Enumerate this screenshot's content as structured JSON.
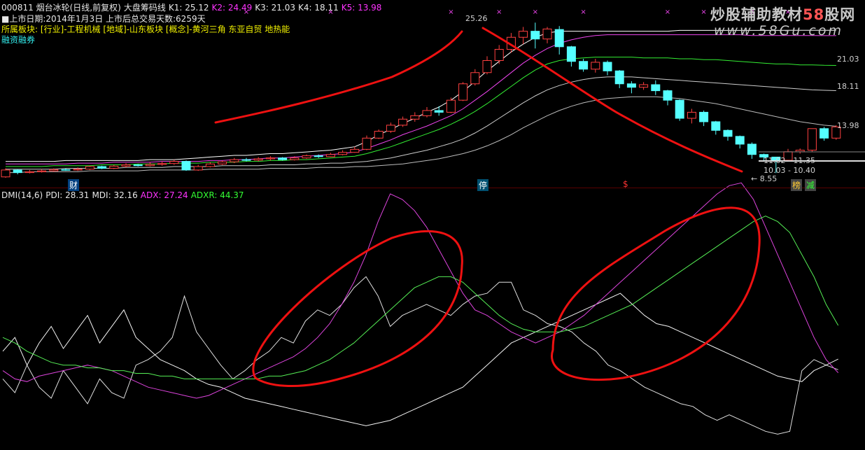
{
  "header": {
    "stock_line": [
      {
        "text": "000811 烟台冰轮(日线,前复权)",
        "color": "white"
      },
      {
        "text": "大盘筹码线",
        "color": "white"
      },
      {
        "text": "K1: 25.12",
        "color": "white"
      },
      {
        "text": "K2: 24.49",
        "color": "magenta"
      },
      {
        "text": "K3: 21.03",
        "color": "white"
      },
      {
        "text": "K4: 18.11",
        "color": "white"
      },
      {
        "text": "K5: 13.98",
        "color": "magenta"
      }
    ],
    "listing_info": "■上市日期:2014年1月3日 上市后总交易天数:6259天",
    "sector_info": "所属板块: [行业]-工程机械 [地域]-山东板块 [概念]-黄河三角 东亚自贸 地热能",
    "margin_tag": "融资融券"
  },
  "watermark": {
    "line1_prefix": "炒股辅助教材",
    "line1_num": "58",
    "line1_suffix": "股网",
    "line2": "www.58Gu.com"
  },
  "price_labels": {
    "peak": "25.26",
    "k3": "21.03",
    "k4": "18.11",
    "k5": "13.98",
    "range1": "11.02 - 11.35",
    "range2": "10.03 - 10.40",
    "low": "← 8.55"
  },
  "markers": {
    "cai": "财",
    "ting": "停",
    "dollar": "$",
    "bang": "榜",
    "jian": "减"
  },
  "dmi_header": [
    {
      "text": "DMI(14,6)",
      "color": "white"
    },
    {
      "text": "PDI: 28.31",
      "color": "white"
    },
    {
      "text": "MDI: 32.16",
      "color": "white"
    },
    {
      "text": "ADX: 27.24",
      "color": "magenta"
    },
    {
      "text": "ADXR: 44.37",
      "color": "green"
    }
  ],
  "chart_data": [
    {
      "type": "candlestick",
      "y_range": [
        8,
        27
      ],
      "candles": [
        [
          8.1,
          8.9,
          8.0,
          9.1
        ],
        [
          8.9,
          8.6,
          8.4,
          9.0
        ],
        [
          8.6,
          8.7,
          8.5,
          8.9
        ],
        [
          8.7,
          8.8,
          8.6,
          9.0
        ],
        [
          8.8,
          8.95,
          8.7,
          9.1
        ],
        [
          8.95,
          8.9,
          8.8,
          9.1
        ],
        [
          8.9,
          9.0,
          8.8,
          9.2
        ],
        [
          9.0,
          9.3,
          8.9,
          9.4
        ],
        [
          9.3,
          9.1,
          9.0,
          9.4
        ],
        [
          9.1,
          9.35,
          9.0,
          9.5
        ],
        [
          9.35,
          9.5,
          9.2,
          9.7
        ],
        [
          9.5,
          9.4,
          9.3,
          9.6
        ],
        [
          9.4,
          9.55,
          9.3,
          9.8
        ],
        [
          9.55,
          9.65,
          9.4,
          9.9
        ],
        [
          9.65,
          9.9,
          9.5,
          10.1
        ],
        [
          9.9,
          8.9,
          8.8,
          10.0
        ],
        [
          8.9,
          9.3,
          8.8,
          9.5
        ],
        [
          9.3,
          9.6,
          9.2,
          9.8
        ],
        [
          9.6,
          9.85,
          9.5,
          10.0
        ],
        [
          9.85,
          10.1,
          9.7,
          10.3
        ],
        [
          10.1,
          10.05,
          9.9,
          10.3
        ],
        [
          10.05,
          10.2,
          9.9,
          10.4
        ],
        [
          10.2,
          10.3,
          10.0,
          10.5
        ],
        [
          10.3,
          10.1,
          10.0,
          10.4
        ],
        [
          10.1,
          10.3,
          10.0,
          10.5
        ],
        [
          10.3,
          10.55,
          10.2,
          10.7
        ],
        [
          10.55,
          10.45,
          10.3,
          10.7
        ],
        [
          10.45,
          10.7,
          10.4,
          10.9
        ],
        [
          10.7,
          10.95,
          10.6,
          11.2
        ],
        [
          10.95,
          11.3,
          10.9,
          11.6
        ],
        [
          11.3,
          12.6,
          11.2,
          12.9
        ],
        [
          12.6,
          13.4,
          12.5,
          13.6
        ],
        [
          13.4,
          14.1,
          13.2,
          14.4
        ],
        [
          14.1,
          14.8,
          13.9,
          15.1
        ],
        [
          14.8,
          15.2,
          14.5,
          15.6
        ],
        [
          15.2,
          15.8,
          15.0,
          16.2
        ],
        [
          15.8,
          15.6,
          15.2,
          16.3
        ],
        [
          15.6,
          17.0,
          15.5,
          17.3
        ],
        [
          17.0,
          18.9,
          16.9,
          19.1
        ],
        [
          18.9,
          20.2,
          18.7,
          20.6
        ],
        [
          20.2,
          21.6,
          20.0,
          22.1
        ],
        [
          21.6,
          22.9,
          21.2,
          23.4
        ],
        [
          22.9,
          24.3,
          22.5,
          24.8
        ],
        [
          24.3,
          25.0,
          23.5,
          25.5
        ],
        [
          25.0,
          24.1,
          23.0,
          26.0
        ],
        [
          24.1,
          25.26,
          23.6,
          25.5
        ],
        [
          25.2,
          23.2,
          22.3,
          25.6
        ],
        [
          23.2,
          21.5,
          20.9,
          23.3
        ],
        [
          21.5,
          20.6,
          20.3,
          21.8
        ],
        [
          20.6,
          21.4,
          20.2,
          21.8
        ],
        [
          21.4,
          20.4,
          19.9,
          21.6
        ],
        [
          20.4,
          18.9,
          18.4,
          20.5
        ],
        [
          18.9,
          18.5,
          17.8,
          19.2
        ],
        [
          18.5,
          18.8,
          18.2,
          19.1
        ],
        [
          18.8,
          18.1,
          17.6,
          19.3
        ],
        [
          18.1,
          17.0,
          16.4,
          18.2
        ],
        [
          17.0,
          14.9,
          14.6,
          17.1
        ],
        [
          14.9,
          15.6,
          14.3,
          16.0
        ],
        [
          15.6,
          14.5,
          14.0,
          15.8
        ],
        [
          14.5,
          13.5,
          13.0,
          14.6
        ],
        [
          13.5,
          12.8,
          12.3,
          13.6
        ],
        [
          12.8,
          11.9,
          11.4,
          12.9
        ],
        [
          11.9,
          10.7,
          10.2,
          12.1
        ],
        [
          10.7,
          10.4,
          10.0,
          10.8
        ],
        [
          10.4,
          10.03,
          8.55,
          10.4
        ],
        [
          10.03,
          11.02,
          9.9,
          11.35
        ],
        [
          11.02,
          11.2,
          10.8,
          11.4
        ],
        [
          11.2,
          13.7,
          11.0,
          13.7
        ],
        [
          13.7,
          12.6,
          12.3,
          13.9
        ],
        [
          12.6,
          13.9,
          12.4,
          14.1
        ]
      ],
      "series": [
        {
          "name": "K1",
          "color": "#ffffff",
          "values": [
            9.9,
            9.9,
            9.9,
            9.9,
            9.9,
            10,
            10,
            10,
            10,
            10,
            10,
            10,
            10.1,
            10.1,
            10.1,
            10.2,
            10.3,
            10.4,
            10.5,
            10.6,
            10.6,
            10.7,
            10.8,
            10.8,
            10.9,
            11,
            11.1,
            11.2,
            11.4,
            11.6,
            12.2,
            13,
            13.6,
            14.3,
            14.9,
            15.6,
            16.2,
            17,
            18,
            19.2,
            20.4,
            21.5,
            22.6,
            23.5,
            24.3,
            24.8,
            25,
            25,
            25,
            25,
            25,
            25,
            25,
            25,
            25,
            25,
            25.1,
            25.1,
            25.1,
            25.1,
            25.1,
            25.1,
            25.1,
            25.1,
            25.1,
            25.12,
            25.12,
            25.12,
            25.12,
            25.12
          ]
        },
        {
          "name": "K2",
          "color": "#ee44ee",
          "values": [
            9.6,
            9.6,
            9.6,
            9.6,
            9.6,
            9.6,
            9.7,
            9.7,
            9.7,
            9.8,
            9.8,
            9.8,
            9.8,
            9.9,
            9.9,
            9.9,
            9.9,
            10,
            10,
            10.1,
            10.1,
            10.2,
            10.3,
            10.3,
            10.4,
            10.5,
            10.6,
            10.7,
            10.8,
            11,
            11.4,
            11.9,
            12.4,
            13,
            13.5,
            14,
            14.6,
            15.2,
            16,
            17,
            18,
            19.1,
            20.2,
            21.3,
            22.2,
            23,
            23.6,
            24,
            24.3,
            24.5,
            24.6,
            24.6,
            24.6,
            24.6,
            24.6,
            24.6,
            24.6,
            24.6,
            24.6,
            24.6,
            24.6,
            24.6,
            24.5,
            24.5,
            24.5,
            24.5,
            24.5,
            24.5,
            24.49,
            24.49
          ]
        },
        {
          "name": "K3",
          "color": "#33ee33",
          "values": [
            9.3,
            9.3,
            9.3,
            9.3,
            9.4,
            9.4,
            9.4,
            9.4,
            9.5,
            9.5,
            9.5,
            9.6,
            9.6,
            9.6,
            9.7,
            9.7,
            9.7,
            9.8,
            9.8,
            9.8,
            9.9,
            9.9,
            10,
            10,
            10.1,
            10.1,
            10.2,
            10.3,
            10.4,
            10.5,
            10.8,
            11.2,
            11.6,
            12.1,
            12.6,
            13.1,
            13.6,
            14.2,
            14.9,
            15.7,
            16.6,
            17.6,
            18.6,
            19.6,
            20.5,
            21.2,
            21.6,
            21.8,
            21.9,
            22,
            22,
            22,
            22,
            21.9,
            21.9,
            21.9,
            21.8,
            21.8,
            21.7,
            21.7,
            21.6,
            21.5,
            21.4,
            21.3,
            21.2,
            21.2,
            21.1,
            21.1,
            21.05,
            21.03
          ]
        },
        {
          "name": "K4",
          "color": "#cccccc",
          "values": [
            9,
            9,
            9,
            9,
            9,
            9.1,
            9.1,
            9.1,
            9.1,
            9.1,
            9.2,
            9.2,
            9.2,
            9.2,
            9.3,
            9.3,
            9.3,
            9.3,
            9.4,
            9.4,
            9.4,
            9.4,
            9.5,
            9.5,
            9.5,
            9.6,
            9.6,
            9.7,
            9.7,
            9.8,
            9.9,
            10.1,
            10.3,
            10.6,
            10.9,
            11.2,
            11.6,
            12,
            12.5,
            13.2,
            14,
            14.9,
            15.8,
            16.7,
            17.5,
            18.2,
            18.7,
            19.1,
            19.4,
            19.6,
            19.7,
            19.7,
            19.7,
            19.6,
            19.5,
            19.4,
            19.3,
            19.2,
            19.1,
            19,
            18.9,
            18.8,
            18.7,
            18.6,
            18.5,
            18.4,
            18.3,
            18.2,
            18.15,
            18.11
          ]
        },
        {
          "name": "K5",
          "color": "#bbbbbb",
          "values": [
            8.6,
            8.6,
            8.7,
            8.7,
            8.7,
            8.7,
            8.7,
            8.8,
            8.8,
            8.8,
            8.8,
            8.8,
            8.9,
            8.9,
            8.9,
            8.9,
            8.9,
            9,
            9,
            9,
            9,
            9,
            9.1,
            9.1,
            9.1,
            9.1,
            9.2,
            9.2,
            9.2,
            9.3,
            9.3,
            9.4,
            9.5,
            9.6,
            9.8,
            10,
            10.2,
            10.5,
            10.8,
            11.2,
            11.7,
            12.3,
            13,
            13.8,
            14.5,
            15.2,
            15.8,
            16.3,
            16.7,
            17,
            17.2,
            17.3,
            17.4,
            17.4,
            17.4,
            17.3,
            17.2,
            17,
            16.8,
            16.6,
            16.3,
            16,
            15.7,
            15.4,
            15.1,
            14.8,
            14.5,
            14.3,
            14.1,
            13.98
          ]
        }
      ]
    },
    {
      "type": "line",
      "y_range": [
        0,
        90
      ],
      "series": [
        {
          "name": "PDI",
          "color": "#e0e0e0",
          "values": [
            25,
            20,
            30,
            22,
            18,
            28,
            22,
            16,
            25,
            20,
            18,
            30,
            32,
            35,
            40,
            55,
            42,
            36,
            30,
            25,
            28,
            32,
            35,
            40,
            38,
            46,
            50,
            48,
            52,
            58,
            62,
            55,
            44,
            48,
            50,
            52,
            50,
            48,
            52,
            55,
            56,
            60,
            60,
            50,
            48,
            45,
            44,
            42,
            38,
            35,
            30,
            28,
            25,
            22,
            20,
            18,
            16,
            15,
            12,
            10,
            12,
            10,
            8,
            6,
            5,
            6,
            28,
            32,
            30,
            28.31
          ]
        },
        {
          "name": "MDI",
          "color": "#f5f5f5",
          "values": [
            35,
            40,
            30,
            38,
            44,
            36,
            42,
            48,
            38,
            44,
            50,
            40,
            36,
            32,
            30,
            28,
            25,
            23,
            22,
            20,
            18,
            17,
            16,
            15,
            14,
            13,
            12,
            11,
            10,
            9,
            8,
            9,
            10,
            12,
            14,
            16,
            18,
            20,
            22,
            26,
            30,
            34,
            38,
            40,
            42,
            44,
            46,
            48,
            50,
            52,
            54,
            56,
            52,
            48,
            45,
            44,
            42,
            40,
            38,
            36,
            34,
            32,
            30,
            28,
            26,
            25,
            24,
            28,
            30,
            32.16
          ]
        },
        {
          "name": "ADX",
          "color": "#dd44dd",
          "values": [
            28,
            25,
            24,
            26,
            27,
            28,
            29,
            30,
            29,
            28,
            26,
            24,
            22,
            21,
            20,
            19,
            18,
            19,
            21,
            23,
            25,
            27,
            29,
            31,
            33,
            36,
            40,
            45,
            52,
            60,
            70,
            82,
            92,
            90,
            86,
            80,
            72,
            64,
            56,
            50,
            48,
            45,
            42,
            40,
            38,
            40,
            42,
            45,
            48,
            52,
            56,
            60,
            64,
            68,
            72,
            76,
            80,
            84,
            88,
            92,
            95,
            96,
            90,
            80,
            70,
            60,
            50,
            40,
            32,
            27.24
          ]
        },
        {
          "name": "ADXR",
          "color": "#55ee55",
          "values": [
            40,
            38,
            35,
            33,
            31,
            30,
            30,
            29,
            29,
            28,
            28,
            27,
            27,
            26,
            26,
            25,
            25,
            25,
            25,
            25,
            25,
            25,
            26,
            26,
            27,
            28,
            30,
            32,
            35,
            38,
            42,
            46,
            50,
            54,
            58,
            60,
            62,
            62,
            60,
            56,
            52,
            48,
            45,
            43,
            42,
            42,
            42,
            43,
            44,
            46,
            48,
            50,
            52,
            55,
            58,
            61,
            64,
            67,
            70,
            73,
            76,
            79,
            82,
            84,
            82,
            78,
            70,
            62,
            52,
            44.37
          ]
        }
      ]
    }
  ]
}
